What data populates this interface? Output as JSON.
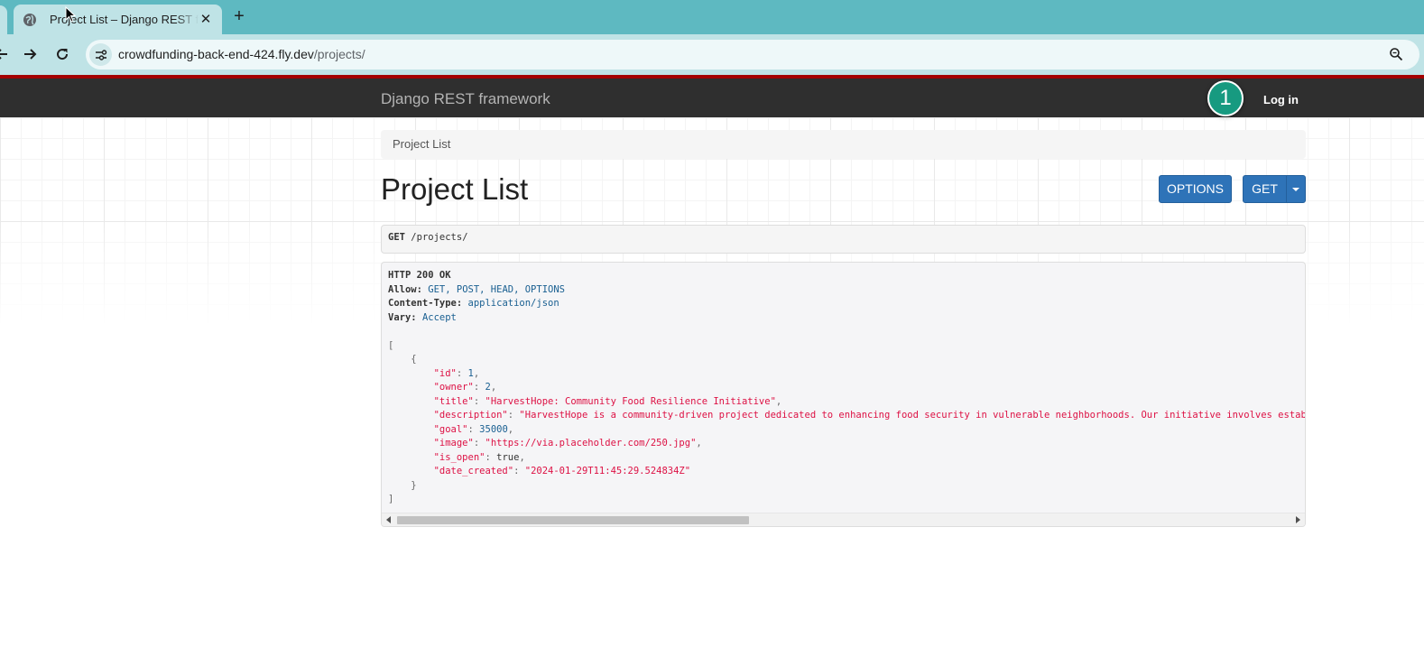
{
  "browser": {
    "tab_title": "Project List – Django REST framework",
    "close_glyph": "✕",
    "new_tab_glyph": "+",
    "url_host": "crowdfunding-back-end-424.fly.dev",
    "url_path": "/projects/",
    "icons": [
      "globe-icon",
      "close-icon",
      "plus-icon",
      "back-icon",
      "forward-icon",
      "reload-icon",
      "site-info-icon",
      "zoom-icon"
    ]
  },
  "navbar": {
    "brand": "Django REST framework",
    "login_label": "Log in",
    "step_badge": "1"
  },
  "breadcrumb": {
    "label": "Project List"
  },
  "page": {
    "title": "Project List",
    "options_label": "OPTIONS",
    "get_label": "GET"
  },
  "request": {
    "method": "GET",
    "path": "/projects/"
  },
  "response": {
    "status": "HTTP 200 OK",
    "headers": [
      {
        "name": "Allow:",
        "value": "GET, POST, HEAD, OPTIONS"
      },
      {
        "name": "Content-Type:",
        "value": "application/json"
      },
      {
        "name": "Vary:",
        "value": "Accept"
      }
    ],
    "body": {
      "open_bracket": "[",
      "open_brace": "{",
      "fields": [
        {
          "key": "\"id\"",
          "value": "1",
          "kind": "lit"
        },
        {
          "key": "\"owner\"",
          "value": "2",
          "kind": "lit"
        },
        {
          "key": "\"title\"",
          "value": "\"HarvestHope: Community Food Resilience Initiative\"",
          "kind": "str"
        },
        {
          "key": "\"description\"",
          "value": "\"HarvestHope is a community-driven project dedicated to enhancing food security in vulnerable neighborhoods. Our initiative involves establishing co",
          "kind": "str"
        },
        {
          "key": "\"goal\"",
          "value": "35000",
          "kind": "lit"
        },
        {
          "key": "\"image\"",
          "value": "\"https://via.placeholder.com/250.jpg\"",
          "kind": "str"
        },
        {
          "key": "\"is_open\"",
          "value": "true",
          "kind": "pln"
        },
        {
          "key": "\"date_created\"",
          "value": "\"2024-01-29T11:45:29.524834Z\"",
          "kind": "str"
        }
      ],
      "close_brace": "}",
      "close_bracket": "]"
    },
    "scroll_position": 0.0
  },
  "colors": {
    "tabstrip": "#5eb9c1",
    "toolbar": "#bfe3e6",
    "navbar": "#2f2f2f",
    "navbar_accent": "#a30000",
    "button": "#2e73b8",
    "badge": "#179a80",
    "string": "#dd1144",
    "literal": "#195f91"
  }
}
